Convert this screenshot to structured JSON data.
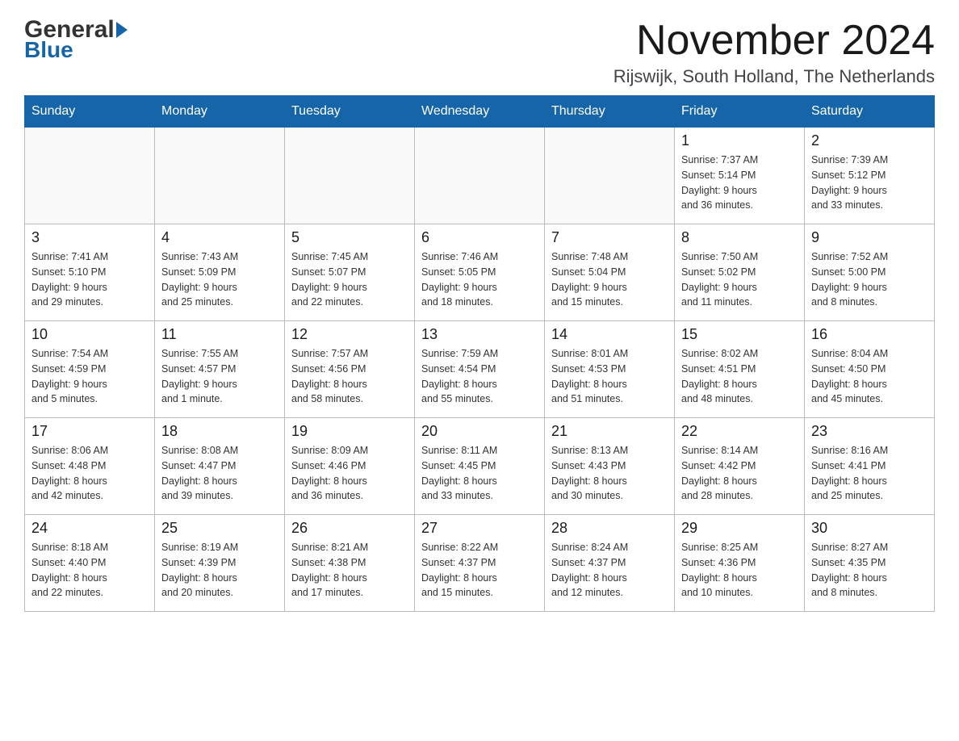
{
  "header": {
    "logo_general": "General",
    "logo_blue": "Blue",
    "month_title": "November 2024",
    "location": "Rijswijk, South Holland, The Netherlands"
  },
  "days_of_week": [
    "Sunday",
    "Monday",
    "Tuesday",
    "Wednesday",
    "Thursday",
    "Friday",
    "Saturday"
  ],
  "weeks": [
    {
      "days": [
        {
          "num": "",
          "info": ""
        },
        {
          "num": "",
          "info": ""
        },
        {
          "num": "",
          "info": ""
        },
        {
          "num": "",
          "info": ""
        },
        {
          "num": "",
          "info": ""
        },
        {
          "num": "1",
          "info": "Sunrise: 7:37 AM\nSunset: 5:14 PM\nDaylight: 9 hours\nand 36 minutes."
        },
        {
          "num": "2",
          "info": "Sunrise: 7:39 AM\nSunset: 5:12 PM\nDaylight: 9 hours\nand 33 minutes."
        }
      ]
    },
    {
      "days": [
        {
          "num": "3",
          "info": "Sunrise: 7:41 AM\nSunset: 5:10 PM\nDaylight: 9 hours\nand 29 minutes."
        },
        {
          "num": "4",
          "info": "Sunrise: 7:43 AM\nSunset: 5:09 PM\nDaylight: 9 hours\nand 25 minutes."
        },
        {
          "num": "5",
          "info": "Sunrise: 7:45 AM\nSunset: 5:07 PM\nDaylight: 9 hours\nand 22 minutes."
        },
        {
          "num": "6",
          "info": "Sunrise: 7:46 AM\nSunset: 5:05 PM\nDaylight: 9 hours\nand 18 minutes."
        },
        {
          "num": "7",
          "info": "Sunrise: 7:48 AM\nSunset: 5:04 PM\nDaylight: 9 hours\nand 15 minutes."
        },
        {
          "num": "8",
          "info": "Sunrise: 7:50 AM\nSunset: 5:02 PM\nDaylight: 9 hours\nand 11 minutes."
        },
        {
          "num": "9",
          "info": "Sunrise: 7:52 AM\nSunset: 5:00 PM\nDaylight: 9 hours\nand 8 minutes."
        }
      ]
    },
    {
      "days": [
        {
          "num": "10",
          "info": "Sunrise: 7:54 AM\nSunset: 4:59 PM\nDaylight: 9 hours\nand 5 minutes."
        },
        {
          "num": "11",
          "info": "Sunrise: 7:55 AM\nSunset: 4:57 PM\nDaylight: 9 hours\nand 1 minute."
        },
        {
          "num": "12",
          "info": "Sunrise: 7:57 AM\nSunset: 4:56 PM\nDaylight: 8 hours\nand 58 minutes."
        },
        {
          "num": "13",
          "info": "Sunrise: 7:59 AM\nSunset: 4:54 PM\nDaylight: 8 hours\nand 55 minutes."
        },
        {
          "num": "14",
          "info": "Sunrise: 8:01 AM\nSunset: 4:53 PM\nDaylight: 8 hours\nand 51 minutes."
        },
        {
          "num": "15",
          "info": "Sunrise: 8:02 AM\nSunset: 4:51 PM\nDaylight: 8 hours\nand 48 minutes."
        },
        {
          "num": "16",
          "info": "Sunrise: 8:04 AM\nSunset: 4:50 PM\nDaylight: 8 hours\nand 45 minutes."
        }
      ]
    },
    {
      "days": [
        {
          "num": "17",
          "info": "Sunrise: 8:06 AM\nSunset: 4:48 PM\nDaylight: 8 hours\nand 42 minutes."
        },
        {
          "num": "18",
          "info": "Sunrise: 8:08 AM\nSunset: 4:47 PM\nDaylight: 8 hours\nand 39 minutes."
        },
        {
          "num": "19",
          "info": "Sunrise: 8:09 AM\nSunset: 4:46 PM\nDaylight: 8 hours\nand 36 minutes."
        },
        {
          "num": "20",
          "info": "Sunrise: 8:11 AM\nSunset: 4:45 PM\nDaylight: 8 hours\nand 33 minutes."
        },
        {
          "num": "21",
          "info": "Sunrise: 8:13 AM\nSunset: 4:43 PM\nDaylight: 8 hours\nand 30 minutes."
        },
        {
          "num": "22",
          "info": "Sunrise: 8:14 AM\nSunset: 4:42 PM\nDaylight: 8 hours\nand 28 minutes."
        },
        {
          "num": "23",
          "info": "Sunrise: 8:16 AM\nSunset: 4:41 PM\nDaylight: 8 hours\nand 25 minutes."
        }
      ]
    },
    {
      "days": [
        {
          "num": "24",
          "info": "Sunrise: 8:18 AM\nSunset: 4:40 PM\nDaylight: 8 hours\nand 22 minutes."
        },
        {
          "num": "25",
          "info": "Sunrise: 8:19 AM\nSunset: 4:39 PM\nDaylight: 8 hours\nand 20 minutes."
        },
        {
          "num": "26",
          "info": "Sunrise: 8:21 AM\nSunset: 4:38 PM\nDaylight: 8 hours\nand 17 minutes."
        },
        {
          "num": "27",
          "info": "Sunrise: 8:22 AM\nSunset: 4:37 PM\nDaylight: 8 hours\nand 15 minutes."
        },
        {
          "num": "28",
          "info": "Sunrise: 8:24 AM\nSunset: 4:37 PM\nDaylight: 8 hours\nand 12 minutes."
        },
        {
          "num": "29",
          "info": "Sunrise: 8:25 AM\nSunset: 4:36 PM\nDaylight: 8 hours\nand 10 minutes."
        },
        {
          "num": "30",
          "info": "Sunrise: 8:27 AM\nSunset: 4:35 PM\nDaylight: 8 hours\nand 8 minutes."
        }
      ]
    }
  ]
}
